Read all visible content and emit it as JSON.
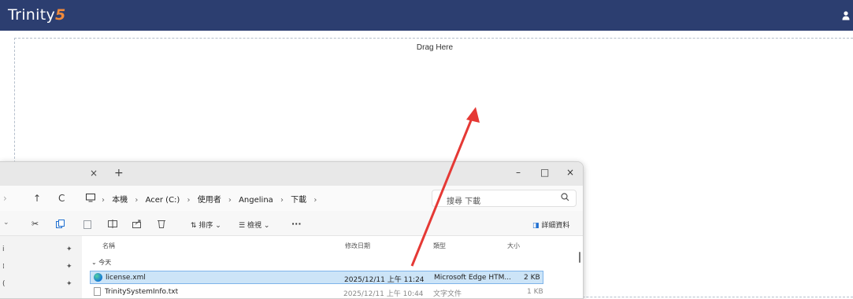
{
  "app": {
    "logo_text": "Trinity",
    "logo_number": "5",
    "brand_color": "#2c3e70",
    "accent_color": "#f08a3c"
  },
  "dropzone": {
    "label": "Drag Here"
  },
  "explorer": {
    "tab_close": "×",
    "tab_new": "+",
    "window": {
      "minimize": "–",
      "maximize": "□",
      "close": "×"
    },
    "nav": {
      "back": "›",
      "up": "↑",
      "refresh": "C"
    },
    "breadcrumbs": [
      "本機",
      "Acer (C:)",
      "使用者",
      "Angelina",
      "下載"
    ],
    "breadcrumb_sep": "›",
    "search_placeholder": "搜尋 下載",
    "commands": {
      "sort": "排序",
      "view": "檢視",
      "more": "···",
      "details": "詳細資料"
    },
    "columns": {
      "name": "名稱",
      "modified": "修改日期",
      "type": "類型",
      "size": "大小"
    },
    "group_label": "今天",
    "files": [
      {
        "name": "license.xml",
        "modified": "2025/12/11 上午 11:24",
        "type": "Microsoft Edge HTM...",
        "size": "2 KB",
        "selected": true,
        "icon": "edge-icon"
      },
      {
        "name": "TrinitySystemInfo.txt",
        "modified": "2025/12/11 上午 10:44",
        "type": "文字文件",
        "size": "1 KB",
        "selected": false,
        "icon": "text-file-icon"
      }
    ]
  },
  "annotation": {
    "arrow_color": "#e53935"
  }
}
